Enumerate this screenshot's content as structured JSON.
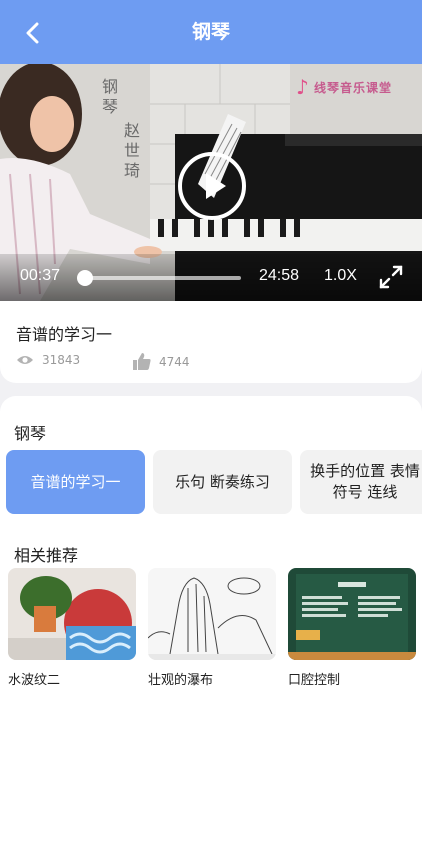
{
  "header": {
    "title": "钢琴"
  },
  "player": {
    "current_time": "00:37",
    "total_time": "24:58",
    "speed": "1.0X",
    "progress": 0.025,
    "overlay_caption": [
      "钢琴",
      "赵世琦"
    ],
    "logo_text": "线琴音乐课堂"
  },
  "lesson": {
    "title": "音谱的学习一",
    "views": "31843",
    "likes": "4744"
  },
  "course": {
    "title": "钢琴",
    "episodes": [
      {
        "label": "音谱的学习一",
        "active": true
      },
      {
        "label": "乐句 断奏练习",
        "active": false
      },
      {
        "label": "换手的位置 表情符号 连线",
        "active": false
      }
    ]
  },
  "related": {
    "title": "相关推荐",
    "items": [
      {
        "title": "水波纹二"
      },
      {
        "title": "壮观的瀑布"
      },
      {
        "title": "口腔控制"
      }
    ]
  },
  "colors": {
    "accent": "#6e9cf2",
    "page_bg": "#f1f1f4"
  }
}
